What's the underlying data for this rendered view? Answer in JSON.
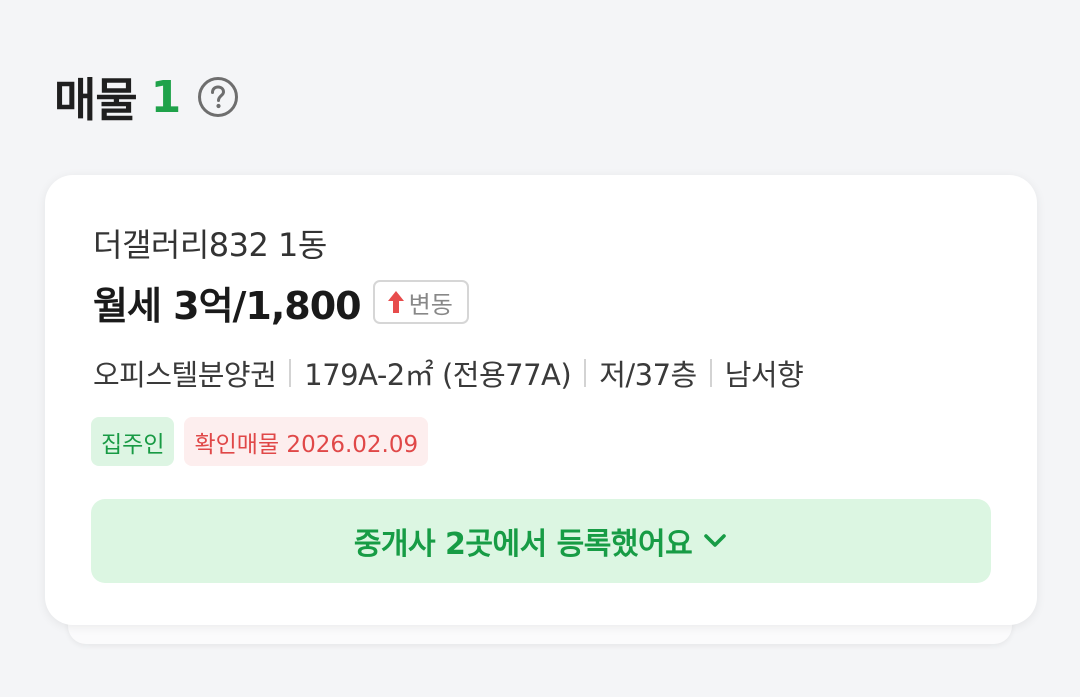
{
  "header": {
    "title": "매물",
    "count": "1",
    "help_icon": "question-circle-icon"
  },
  "listing": {
    "name": "더갤러리832 1동",
    "price": "월세 3억/1,800",
    "change_badge": {
      "label": "변동",
      "icon": "arrow-up-icon",
      "icon_color": "#e74c4c"
    },
    "details": {
      "type": "오피스텔분양권",
      "area": "179A-2㎡ (전용77A)",
      "floor": "저/37층",
      "direction": "남서향"
    },
    "tags": {
      "owner": "집주인",
      "verified": "확인매물 2026.02.09"
    },
    "agent_button": {
      "label": "중개사 2곳에서 등록했어요",
      "icon": "chevron-down-icon"
    }
  },
  "colors": {
    "accent_green": "#1fa24a",
    "alert_red": "#e04848",
    "background": "#f4f5f7"
  }
}
